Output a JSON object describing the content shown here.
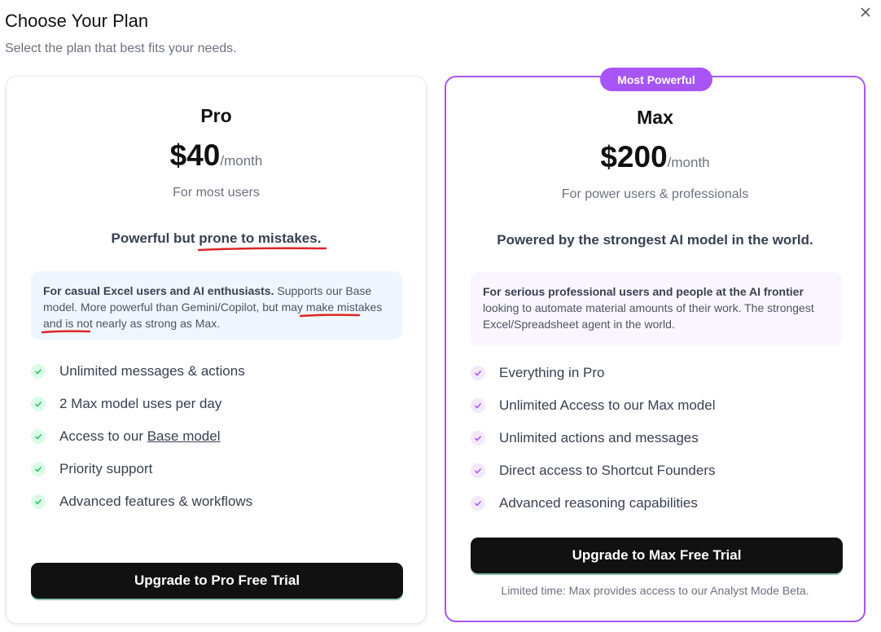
{
  "dialog": {
    "title": "Choose Your Plan",
    "subtitle": "Select the plan that best fits your needs.",
    "close_icon": "close-icon"
  },
  "plans": [
    {
      "name": "Pro",
      "price": "$40",
      "period": "/month",
      "audience": "For most users",
      "tagline_prefix": "Powerful but ",
      "tagline_underlined": "prone to mistakes.",
      "desc_bold": "For casual Excel users and AI enthusiasts.",
      "desc_text_1": " Supports our Base model. More powerful than Gemini/Copilot, but ",
      "desc_underlined": "may make mistakes",
      "desc_text_2": " and is not nearly as strong as Max.",
      "features": [
        "Unlimited messages & actions",
        "2 Max model uses per day",
        "Access to our ",
        "Priority support",
        "Advanced features & workflows"
      ],
      "feature_link": "Base model",
      "cta": "Upgrade to Pro Free Trial",
      "check_color": "#22c55e"
    },
    {
      "name": "Max",
      "badge": "Most Powerful",
      "price": "$200",
      "period": "/month",
      "audience": "For power users & professionals",
      "tagline": "Powered by the strongest AI model in the world.",
      "desc_bold": "For serious professional users and people at the AI frontier",
      "desc_text": " looking to automate material amounts of their work. The strongest Excel/Spreadsheet agent in the world.",
      "features": [
        "Everything in Pro",
        "Unlimited Access to our Max model",
        "Unlimited actions and messages",
        "Direct access to Shortcut Founders",
        "Advanced reasoning capabilities"
      ],
      "cta": "Upgrade to Max Free Trial",
      "note": "Limited time: Max provides access to our Analyst Mode Beta.",
      "check_color": "#a855f7",
      "accent": "#a855f7"
    }
  ]
}
